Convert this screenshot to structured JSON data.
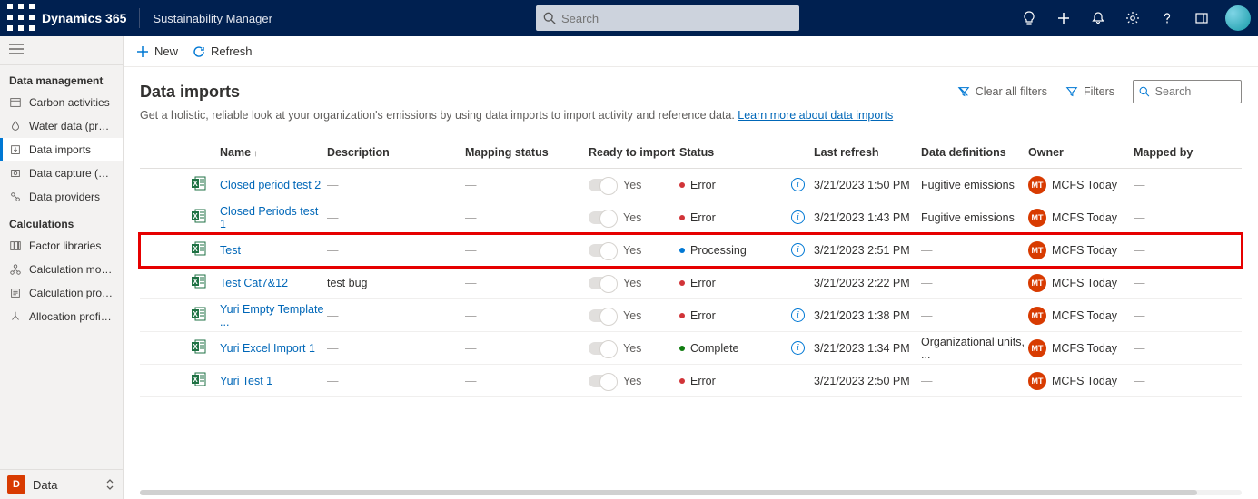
{
  "top": {
    "app": "Dynamics 365",
    "sub": "Sustainability Manager",
    "search_placeholder": "Search"
  },
  "cmd": {
    "new": "New",
    "refresh": "Refresh"
  },
  "sidebar": {
    "sections": {
      "data": "Data management",
      "calc": "Calculations"
    },
    "items": [
      "Carbon activities",
      "Water data (preview)",
      "Data imports",
      "Data capture (preview)",
      "Data providers",
      "Factor libraries",
      "Calculation models",
      "Calculation profiles",
      "Allocation profiles (p..."
    ],
    "footer": {
      "badge": "D",
      "label": "Data"
    }
  },
  "page": {
    "title": "Data imports",
    "subtext": "Get a holistic, reliable look at your organization's emissions by using data imports to import activity and reference data. ",
    "learn": "Learn more about data imports",
    "clear_filters": "Clear all filters",
    "filters": "Filters",
    "search_placeholder": "Search"
  },
  "columns": {
    "name": "Name",
    "description": "Description",
    "mapping": "Mapping status",
    "ready": "Ready to import",
    "status": "Status",
    "last_refresh": "Last refresh",
    "definitions": "Data definitions",
    "owner": "Owner",
    "mapped_by": "Mapped by"
  },
  "rows": [
    {
      "name": "Closed period test 2",
      "description": "—",
      "mapping": "—",
      "ready": "Yes",
      "status": "Error",
      "status_color": "#d13438",
      "info": true,
      "last_refresh": "3/21/2023 1:50 PM",
      "definitions": "Fugitive emissions",
      "owner": "MCFS Today",
      "mapped_by": "—",
      "highlight": false
    },
    {
      "name": "Closed Periods test 1",
      "description": "—",
      "mapping": "—",
      "ready": "Yes",
      "status": "Error",
      "status_color": "#d13438",
      "info": true,
      "last_refresh": "3/21/2023 1:43 PM",
      "definitions": "Fugitive emissions",
      "owner": "MCFS Today",
      "mapped_by": "—",
      "highlight": false
    },
    {
      "name": "Test",
      "description": "—",
      "mapping": "—",
      "ready": "Yes",
      "status": "Processing",
      "status_color": "#0078d4",
      "info": true,
      "last_refresh": "3/21/2023 2:51 PM",
      "definitions": "—",
      "owner": "MCFS Today",
      "mapped_by": "—",
      "highlight": true
    },
    {
      "name": "Test Cat7&12",
      "description": "test bug",
      "mapping": "—",
      "ready": "Yes",
      "status": "Error",
      "status_color": "#d13438",
      "info": false,
      "last_refresh": "3/21/2023 2:22 PM",
      "definitions": "—",
      "owner": "MCFS Today",
      "mapped_by": "—",
      "highlight": false
    },
    {
      "name": "Yuri Empty Template ...",
      "description": "—",
      "mapping": "—",
      "ready": "Yes",
      "status": "Error",
      "status_color": "#d13438",
      "info": true,
      "last_refresh": "3/21/2023 1:38 PM",
      "definitions": "—",
      "owner": "MCFS Today",
      "mapped_by": "—",
      "highlight": false
    },
    {
      "name": "Yuri Excel Import 1",
      "description": "—",
      "mapping": "—",
      "ready": "Yes",
      "status": "Complete",
      "status_color": "#107c10",
      "info": true,
      "last_refresh": "3/21/2023 1:34 PM",
      "definitions": "Organizational units, ...",
      "owner": "MCFS Today",
      "mapped_by": "—",
      "highlight": false
    },
    {
      "name": "Yuri Test 1",
      "description": "—",
      "mapping": "—",
      "ready": "Yes",
      "status": "Error",
      "status_color": "#d13438",
      "info": false,
      "last_refresh": "3/21/2023 2:50 PM",
      "definitions": "—",
      "owner": "MCFS Today",
      "mapped_by": "—",
      "highlight": false
    }
  ]
}
